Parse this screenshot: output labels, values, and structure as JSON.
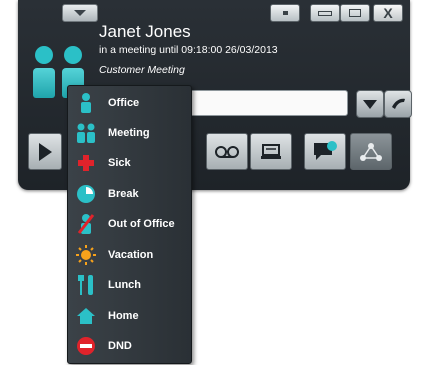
{
  "header": {
    "name": "Janet Jones",
    "status_line": "in a meeting until 09:18:00 26/03/2013",
    "meeting_title": "Customer Meeting"
  },
  "window_controls": {
    "close_label": "X"
  },
  "status_menu": {
    "items": [
      {
        "label": "Office",
        "icon": "person-icon"
      },
      {
        "label": "Meeting",
        "icon": "people-icon"
      },
      {
        "label": "Sick",
        "icon": "red-cross-icon"
      },
      {
        "label": "Break",
        "icon": "clock-icon"
      },
      {
        "label": "Out of Office",
        "icon": "out-of-office-icon"
      },
      {
        "label": "Vacation",
        "icon": "sun-icon"
      },
      {
        "label": "Lunch",
        "icon": "cutlery-icon"
      },
      {
        "label": "Home",
        "icon": "house-icon"
      },
      {
        "label": "DND",
        "icon": "do-not-disturb-icon"
      }
    ]
  },
  "colors": {
    "window_bg": "#24292e",
    "accent_teal": "#2bc0c7",
    "menu_bg": "#343a40"
  }
}
